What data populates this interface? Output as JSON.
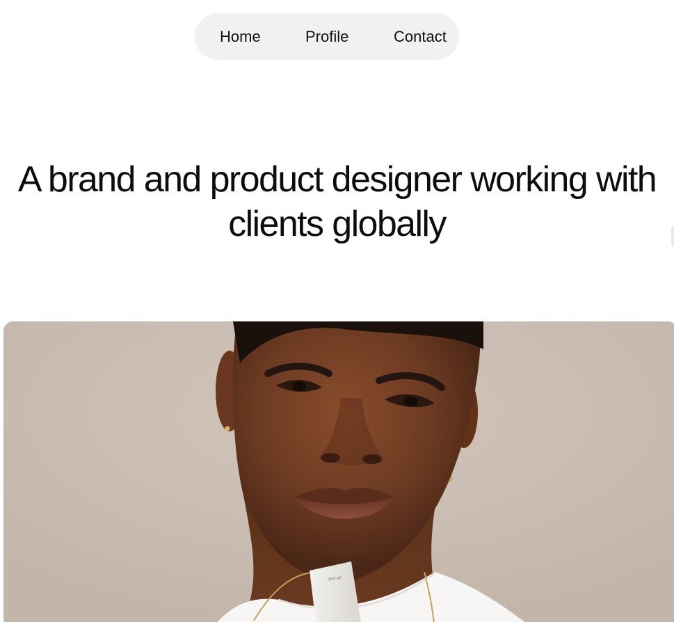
{
  "nav": {
    "items": [
      {
        "label": "Home"
      },
      {
        "label": "Profile"
      },
      {
        "label": "Contact"
      }
    ]
  },
  "hero": {
    "headline": "A brand and product designer working with clients globally"
  },
  "image": {
    "subject": "portrait-photo",
    "product_label": "cbd oil"
  },
  "colors": {
    "nav_background": "#f2f1ef",
    "text": "#111111",
    "photo_background": "#c9bdb3",
    "skin": "#6b3a22"
  }
}
